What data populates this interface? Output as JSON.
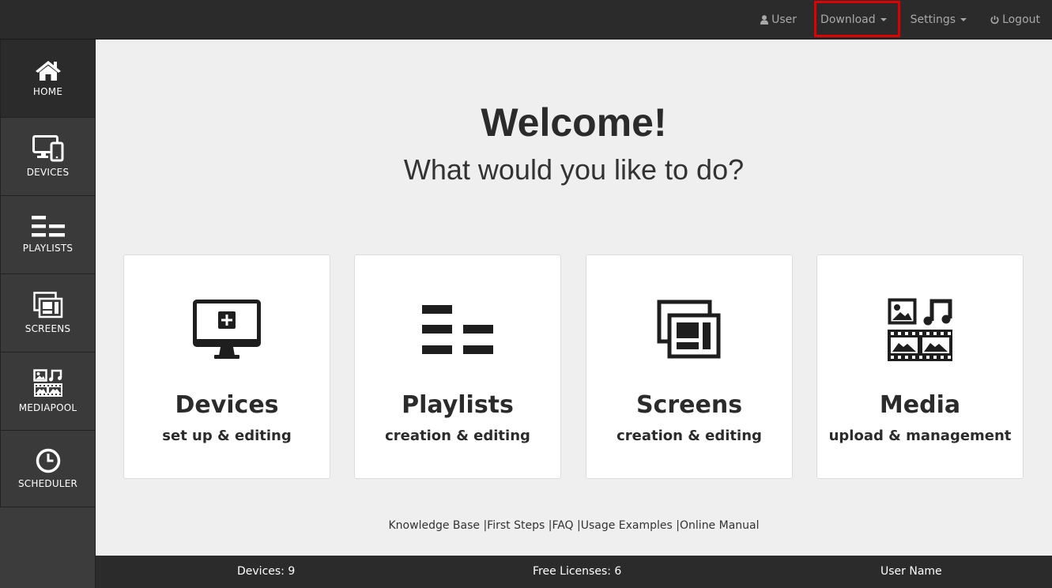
{
  "topnav": {
    "user_label": "User",
    "download_label": "Download",
    "settings_label": "Settings",
    "logout_label": "Logout"
  },
  "sidebar": {
    "items": [
      {
        "label": "HOME",
        "icon": "home-icon"
      },
      {
        "label": "DEVICES",
        "icon": "devices-icon"
      },
      {
        "label": "PLAYLISTS",
        "icon": "playlists-icon"
      },
      {
        "label": "SCREENS",
        "icon": "screens-icon"
      },
      {
        "label": "MEDIAPOOL",
        "icon": "mediapool-icon"
      },
      {
        "label": "SCHEDULER",
        "icon": "clock-icon"
      }
    ]
  },
  "main": {
    "title": "Welcome!",
    "subtitle": "What would you like to do?",
    "cards": [
      {
        "title": "Devices",
        "subtitle": "set up & editing",
        "icon": "monitor-plus-icon"
      },
      {
        "title": "Playlists",
        "subtitle": "creation & editing",
        "icon": "playlists-icon"
      },
      {
        "title": "Screens",
        "subtitle": "creation & editing",
        "icon": "screens-icon"
      },
      {
        "title": "Media",
        "subtitle": "upload & management",
        "icon": "media-icon"
      }
    ],
    "footer_links": [
      "Knowledge Base",
      "First Steps",
      "FAQ",
      "Usage Examples",
      "Online Manual"
    ]
  },
  "statusbar": {
    "devices": "Devices: 9",
    "licenses": "Free Licenses: 6",
    "user_name": "User Name"
  },
  "colors": {
    "topbar": "#2b2b2b",
    "sidebar": "#3c3c3c",
    "highlight": "#e10000",
    "background": "#efefef"
  }
}
